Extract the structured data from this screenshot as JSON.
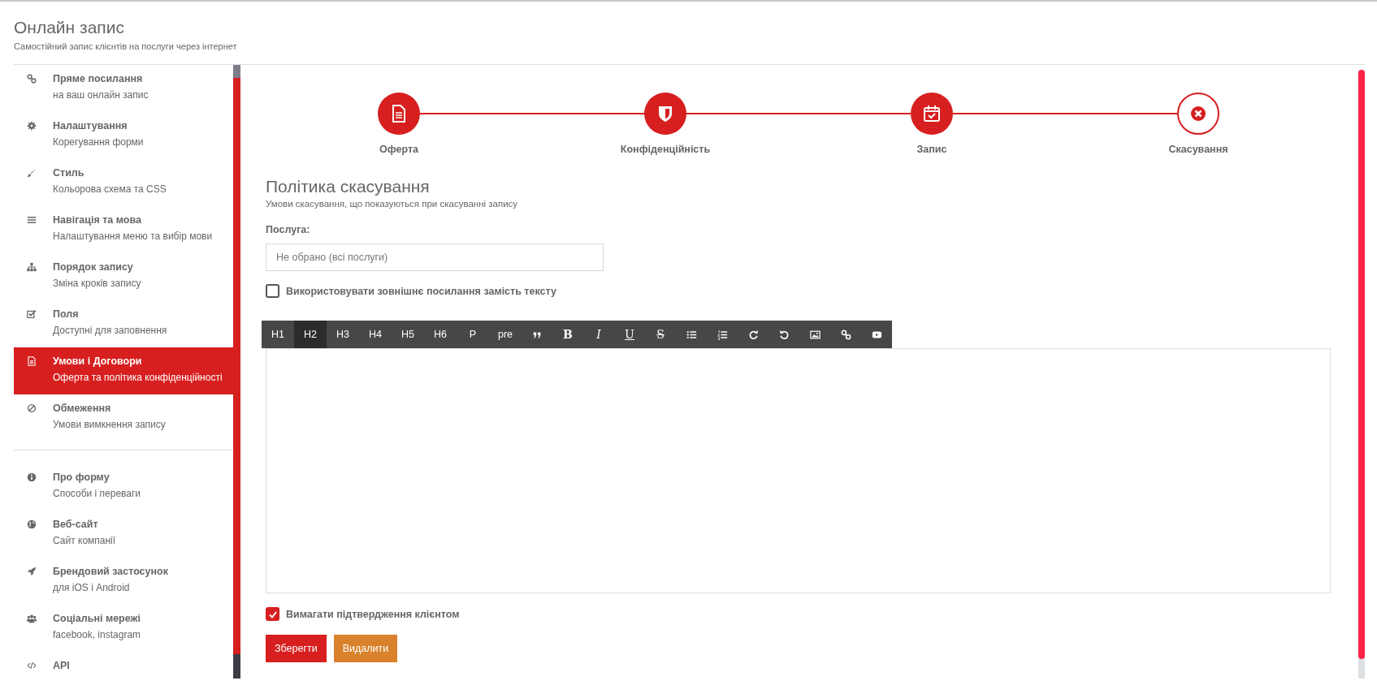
{
  "header": {
    "title": "Онлайн запис",
    "subtitle": "Самостійний запис клієнтів на послуги через інтернет"
  },
  "sidebar": {
    "sections": [
      {
        "items": [
          {
            "kind": "link",
            "title": "Пряме посилання",
            "subtitle": "на ваш онлайн запис",
            "selected": false
          },
          {
            "kind": "gear",
            "title": "Налаштування",
            "subtitle": "Корегування форми",
            "selected": false
          },
          {
            "kind": "brush",
            "title": "Стиль",
            "subtitle": "Кольорова схема та CSS",
            "selected": false
          },
          {
            "kind": "menu",
            "title": "Навігація та мова",
            "subtitle": "Налаштування меню та вибір мови",
            "selected": false
          },
          {
            "kind": "sitemap",
            "title": "Порядок запису",
            "subtitle": "Зміна кроків запису",
            "selected": false
          },
          {
            "kind": "checkbox",
            "title": "Поля",
            "subtitle": "Доступні для заповнення",
            "selected": false
          },
          {
            "kind": "document",
            "title": "Умови і Договори",
            "subtitle": "Оферта та політика конфіденційності",
            "selected": true
          },
          {
            "kind": "ban",
            "title": "Обмеження",
            "subtitle": "Умови вимкнення запису",
            "selected": false
          }
        ]
      },
      {
        "items": [
          {
            "kind": "info",
            "title": "Про форму",
            "subtitle": "Способи і переваги",
            "selected": false
          },
          {
            "kind": "globe",
            "title": "Веб-сайт",
            "subtitle": "Сайт компанії",
            "selected": false
          },
          {
            "kind": "rocket",
            "title": "Брендовий застосунок",
            "subtitle": "для iOS і Android",
            "selected": false
          },
          {
            "kind": "users",
            "title": "Соціальні мережі",
            "subtitle": "facebook, instagram",
            "selected": false
          },
          {
            "kind": "code",
            "title": "API",
            "selected": false
          }
        ]
      }
    ]
  },
  "steps": [
    {
      "kind": "document",
      "label": "Оферта",
      "selected": false
    },
    {
      "kind": "shield",
      "label": "Конфіденційність",
      "selected": false
    },
    {
      "kind": "calendar",
      "label": "Запис",
      "selected": false
    },
    {
      "kind": "cancel",
      "label": "Скасування",
      "selected": true
    }
  ],
  "form": {
    "title": "Політика скасування",
    "subtitle": "Умови скасування, що показуються при скасуванні запису",
    "service_label": "Послуга:",
    "service_placeholder": "Не обрано (всі послуги)",
    "external_link": {
      "label": "Використовувати зовнішнє посилання замість тексту",
      "checked": false
    },
    "toolbar": [
      {
        "kind": "text",
        "label": "H1",
        "selected": false
      },
      {
        "kind": "text",
        "label": "H2",
        "selected": true
      },
      {
        "kind": "text",
        "label": "H3",
        "selected": false
      },
      {
        "kind": "text",
        "label": "H4",
        "selected": false
      },
      {
        "kind": "text",
        "label": "H5",
        "selected": false
      },
      {
        "kind": "text",
        "label": "H6",
        "selected": false
      },
      {
        "kind": "text",
        "label": "P",
        "selected": false
      },
      {
        "kind": "text",
        "label": "pre",
        "selected": false
      },
      {
        "kind": "quote",
        "selected": false
      },
      {
        "kind": "bold",
        "label": "B",
        "selected": false
      },
      {
        "kind": "italic",
        "label": "I",
        "selected": false
      },
      {
        "kind": "underline",
        "label": "U",
        "selected": false
      },
      {
        "kind": "strike",
        "label": "S",
        "selected": false
      },
      {
        "kind": "bullets",
        "selected": false
      },
      {
        "kind": "numbers",
        "selected": false
      },
      {
        "kind": "redo",
        "selected": false
      },
      {
        "kind": "undo",
        "selected": false
      },
      {
        "kind": "image",
        "selected": false
      },
      {
        "kind": "link",
        "selected": false
      },
      {
        "kind": "video",
        "selected": false
      }
    ],
    "confirm": {
      "label": "Вимагати підтвердження клієнтом",
      "checked": true
    },
    "buttons": [
      {
        "kind": "primary",
        "label": "Зберегти"
      },
      {
        "kind": "danger",
        "label": "Видалити"
      }
    ]
  }
}
